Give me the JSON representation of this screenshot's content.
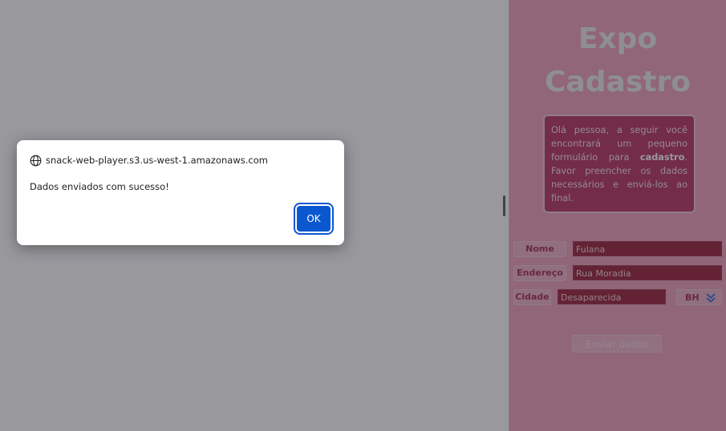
{
  "app": {
    "title_line1": "Expo",
    "title_line2": "Cadastro",
    "intro": {
      "before": "Olá pessoa, a seguir você encontrará um pequeno formulário para ",
      "bold": "cadastro",
      "after": ". Favor preencher os dados necessários e enviá-los ao final."
    },
    "fields": {
      "nome_label": "Nome",
      "nome_value": "Fulana",
      "endereco_label": "Endereço",
      "endereco_value": "Rua Moradia",
      "cidade_label": "Cidade",
      "cidade_value": "Desaparecida",
      "estado_value": "BH"
    },
    "submit_label": "Enviar dados"
  },
  "dialog": {
    "origin": "snack-web-player.s3.us-west-1.amazonaws.com",
    "message": "Dados enviados com sucesso!",
    "ok_label": "OK"
  },
  "colors": {
    "app_background": "#ef9fb8",
    "intro_box": "#b8305e",
    "field_fill": "#9c2036",
    "label_text": "#a9284f",
    "ok_button": "#0b57d0"
  },
  "icons": {
    "origin": "globe-icon",
    "select": "double-chevron-down-icon"
  }
}
